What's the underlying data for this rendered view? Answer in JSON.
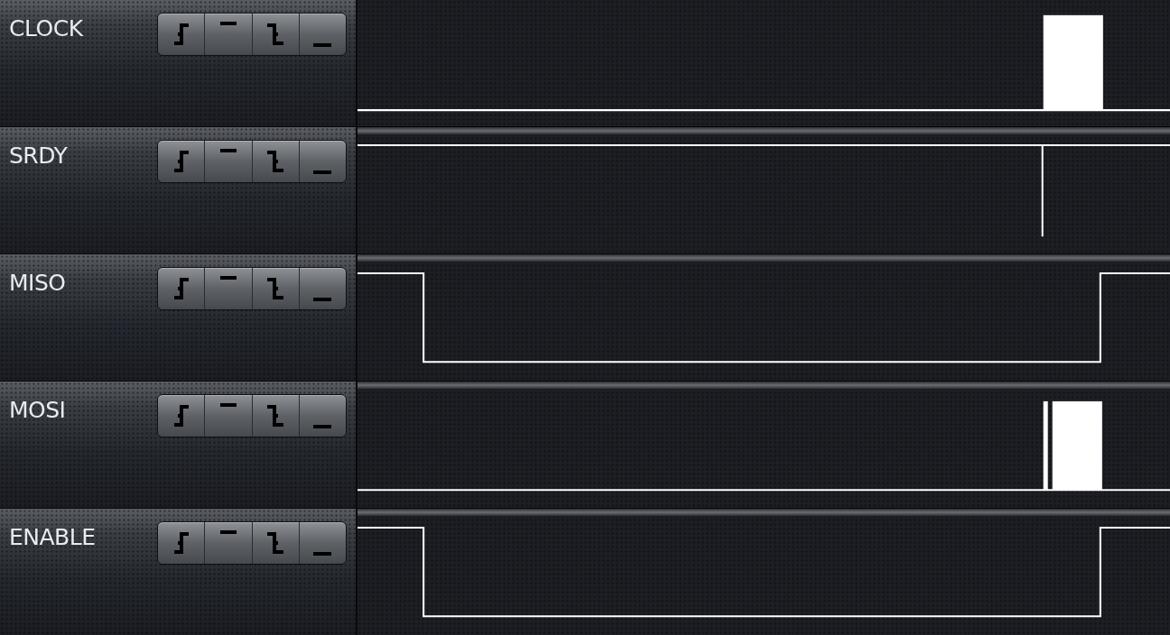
{
  "channels": [
    {
      "name": "CLOCK",
      "kind": "burst"
    },
    {
      "name": "SRDY",
      "kind": "glitch"
    },
    {
      "name": "MISO",
      "kind": "frame"
    },
    {
      "name": "MOSI",
      "kind": "split_burst"
    },
    {
      "name": "ENABLE",
      "kind": "frame"
    }
  ]
}
